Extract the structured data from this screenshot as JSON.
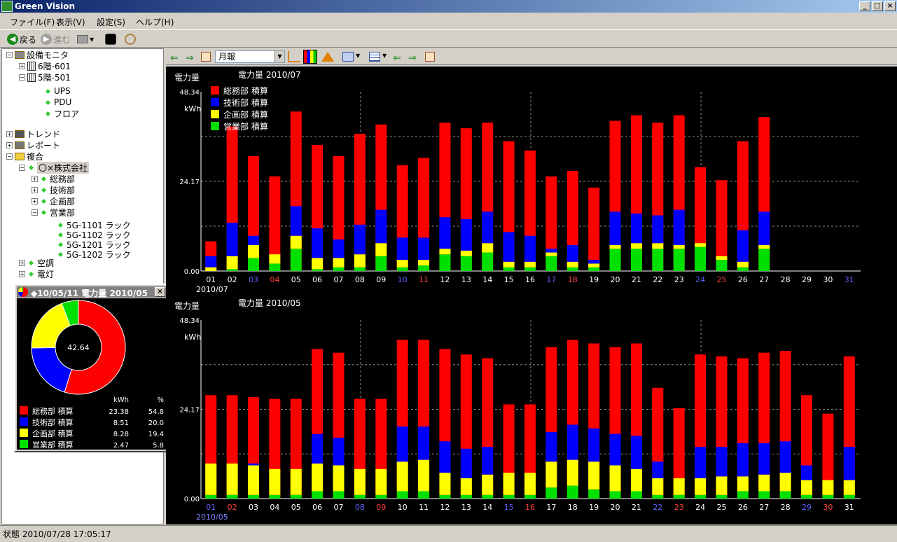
{
  "window": {
    "title": "Green Vision"
  },
  "menu": [
    "ファイル(F)",
    "表示(V)",
    "設定(S)",
    "ヘルプ(H)"
  ],
  "toolbar": {
    "back": "戻る",
    "forward": "進む"
  },
  "tree": {
    "root": "設備モニタ",
    "floor6": "6階-601",
    "floor5": "5階-501",
    "ups": "UPS",
    "pdu": "PDU",
    "floor": "フロア",
    "trend": "トレンド",
    "report": "レポート",
    "composite": "複合",
    "company": "〇×株式会社",
    "dept1": "総務部",
    "dept2": "技術部",
    "dept3": "企画部",
    "dept4": "営業部",
    "rack1": "5G-1101 ラック",
    "rack2": "5G-1102 ラック",
    "rack3": "5G-1201 ラック",
    "rack4": "5G-1202 ラック",
    "aircon": "空調",
    "light": "電灯"
  },
  "popup": {
    "title": "◆10/05/11 電力量 2010/05",
    "total": "42.64",
    "hdr_kwh": "kWh",
    "hdr_pct": "%",
    "rows": [
      {
        "label": "総務部 積算",
        "kwh": "23.38",
        "pct": "54.8",
        "color": "#ff0000",
        "frac": 0.548
      },
      {
        "label": "技術部 積算",
        "kwh": "8.51",
        "pct": "20.0",
        "color": "#0000ff",
        "frac": 0.2
      },
      {
        "label": "企画部 積算",
        "kwh": "8.28",
        "pct": "19.4",
        "color": "#ffff00",
        "frac": 0.194
      },
      {
        "label": "営業部 積算",
        "kwh": "2.47",
        "pct": "5.8",
        "color": "#00e000",
        "frac": 0.058
      }
    ]
  },
  "main_toolbar": {
    "period": "月報"
  },
  "chart_data": [
    {
      "type": "bar",
      "title": "電力量 2010/07",
      "ylabel": "電力量",
      "unit": "kWh",
      "yticks": [
        "48.34",
        "24.17",
        "0.00"
      ],
      "ylim": [
        0,
        48.34
      ],
      "month_label": "2010/07",
      "legend": [
        "総務部 積算",
        "技術部 積算",
        "企画部 積算",
        "営業部 積算"
      ],
      "colors": [
        "#ff0000",
        "#0000ff",
        "#ffff00",
        "#00e000"
      ],
      "categories": [
        "01",
        "02",
        "03",
        "04",
        "05",
        "06",
        "07",
        "08",
        "09",
        "10",
        "11",
        "12",
        "13",
        "14",
        "15",
        "16",
        "17",
        "18",
        "19",
        "20",
        "21",
        "22",
        "23",
        "24",
        "25",
        "26",
        "27",
        "28",
        "29",
        "30",
        "31"
      ],
      "cat_colors": [
        "w",
        "w",
        "b",
        "r",
        "w",
        "w",
        "w",
        "w",
        "w",
        "b",
        "r",
        "w",
        "w",
        "w",
        "w",
        "w",
        "b",
        "r",
        "w",
        "w",
        "w",
        "w",
        "w",
        "b",
        "r",
        "w",
        "w",
        "w",
        "w",
        "w",
        "b"
      ],
      "totals": [
        8,
        39,
        31,
        25.5,
        43,
        34,
        31,
        37,
        39.5,
        28.5,
        30.5,
        40,
        38.5,
        40,
        35,
        32.5,
        25.5,
        27,
        22.5,
        40.5,
        42,
        40,
        42,
        28,
        24.5,
        35,
        41.5,
        0,
        0,
        0,
        0
      ],
      "series": [
        {
          "name": "営業部 積算",
          "values": [
            0,
            0.5,
            3.5,
            2,
            6,
            0.5,
            1,
            1,
            4,
            1,
            1.5,
            4.5,
            4,
            5,
            1,
            1,
            4,
            1,
            1,
            6,
            6,
            6,
            6,
            6.5,
            3,
            1,
            6,
            0,
            0,
            0,
            0
          ]
        },
        {
          "name": "企画部 積算",
          "values": [
            1,
            3.5,
            3.5,
            2.5,
            3.5,
            3,
            2.5,
            3.5,
            3.5,
            2,
            1.5,
            1.5,
            1.5,
            2.5,
            1.5,
            1.5,
            1,
            1.5,
            1,
            1,
            1.5,
            1.5,
            1,
            1,
            1,
            1.5,
            1,
            0,
            0,
            0,
            0
          ]
        },
        {
          "name": "技術部 積算",
          "values": [
            3,
            9,
            2.5,
            0,
            8,
            8,
            5,
            8,
            9,
            6,
            6,
            8.5,
            8.5,
            8.5,
            8,
            7,
            1,
            4.5,
            1,
            9,
            8,
            7.5,
            9.5,
            0,
            0,
            8.5,
            9,
            0,
            0,
            0,
            0
          ]
        }
      ]
    },
    {
      "type": "bar",
      "title": "電力量 2010/05",
      "ylabel": "電力量",
      "unit": "kWh",
      "yticks": [
        "48.34",
        "24.17",
        "0.00"
      ],
      "ylim": [
        0,
        48.34
      ],
      "month_label": "2010/05",
      "categories": [
        "01",
        "02",
        "03",
        "04",
        "05",
        "06",
        "07",
        "08",
        "09",
        "10",
        "11",
        "12",
        "13",
        "14",
        "15",
        "16",
        "17",
        "18",
        "19",
        "20",
        "21",
        "22",
        "23",
        "24",
        "25",
        "26",
        "27",
        "28",
        "29",
        "30",
        "31"
      ],
      "cat_colors": [
        "b",
        "r",
        "w",
        "w",
        "w",
        "w",
        "w",
        "b",
        "r",
        "w",
        "w",
        "w",
        "w",
        "w",
        "b",
        "r",
        "w",
        "w",
        "w",
        "w",
        "w",
        "b",
        "r",
        "w",
        "w",
        "w",
        "w",
        "w",
        "b",
        "r",
        "w"
      ],
      "totals": [
        28,
        28,
        27.5,
        27,
        27,
        40.5,
        39.5,
        27,
        27,
        43,
        43,
        40.5,
        39,
        38,
        25.5,
        25.5,
        41,
        43,
        42,
        41,
        42,
        30,
        24.5,
        39,
        38.5,
        38,
        39.5,
        40,
        28,
        23,
        38.5
      ],
      "series": [
        {
          "name": "営業部 積算",
          "values": [
            1,
            1,
            1,
            1,
            1,
            2,
            2,
            1,
            1,
            2,
            2,
            1,
            1,
            1,
            1,
            1,
            3,
            3.5,
            2.5,
            2,
            2,
            1,
            1,
            1,
            1,
            2,
            2,
            2,
            1,
            1,
            1
          ]
        },
        {
          "name": "企画部 積算",
          "values": [
            8.5,
            8.5,
            8,
            7,
            7,
            7.5,
            7,
            7,
            7,
            8,
            8.5,
            6,
            4.5,
            5.5,
            6,
            6,
            7,
            7,
            7.5,
            7,
            6,
            4.5,
            4.5,
            4.5,
            5,
            4,
            4.5,
            5,
            4,
            4,
            4
          ]
        },
        {
          "name": "技術部 積算",
          "values": [
            0,
            0,
            0.5,
            0,
            0,
            8,
            7.5,
            0,
            0,
            9.5,
            9,
            8.5,
            8,
            7.5,
            0,
            0,
            8,
            9.5,
            9,
            8.5,
            9,
            4.5,
            0,
            8.5,
            8,
            9,
            8.5,
            8.5,
            4,
            0,
            9
          ]
        }
      ]
    }
  ],
  "status": "状態  2010/07/28 17:05:17"
}
